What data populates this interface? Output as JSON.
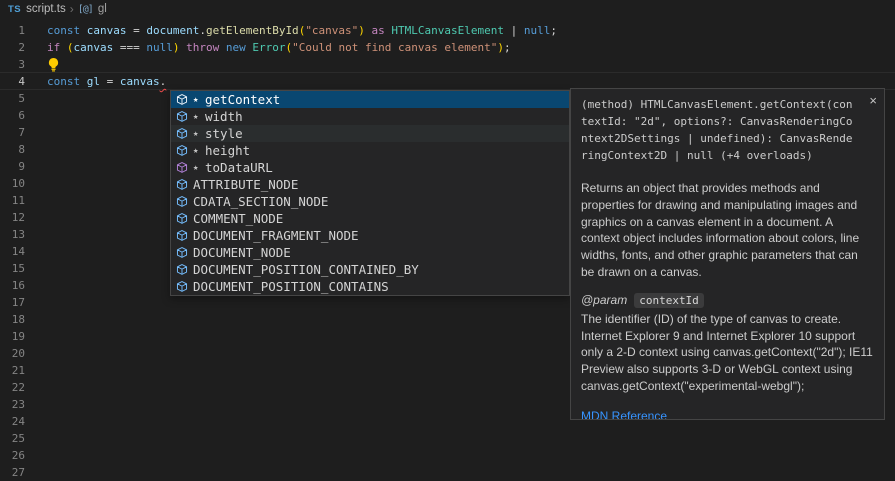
{
  "breadcrumb": {
    "file_icon": "TS",
    "file": "script.ts",
    "separator": "›",
    "symbol_icon": "[@]",
    "symbol": "gl"
  },
  "editor": {
    "line_count": 27,
    "active_line": 4,
    "code_lines": [
      {
        "line": 1,
        "tokens": [
          {
            "t": "const ",
            "c": "kw"
          },
          {
            "t": "canvas ",
            "c": "var"
          },
          {
            "t": "= ",
            "c": "op"
          },
          {
            "t": "document",
            "c": "var"
          },
          {
            "t": ".",
            "c": "op"
          },
          {
            "t": "getElementById",
            "c": "fn"
          },
          {
            "t": "(",
            "c": "br"
          },
          {
            "t": "\"canvas\"",
            "c": "str"
          },
          {
            "t": ")",
            "c": "br"
          },
          {
            "t": " as ",
            "c": "ctrl"
          },
          {
            "t": "HTMLCanvasElement ",
            "c": "type"
          },
          {
            "t": "| ",
            "c": "op"
          },
          {
            "t": "null",
            "c": "kw"
          },
          {
            "t": ";",
            "c": "op"
          }
        ]
      },
      {
        "line": 2,
        "tokens": [
          {
            "t": "if ",
            "c": "ctrl"
          },
          {
            "t": "(",
            "c": "br"
          },
          {
            "t": "canvas ",
            "c": "var"
          },
          {
            "t": "=== ",
            "c": "op"
          },
          {
            "t": "null",
            "c": "kw"
          },
          {
            "t": ")",
            "c": "br"
          },
          {
            "t": " throw ",
            "c": "ctrl"
          },
          {
            "t": "new ",
            "c": "kw"
          },
          {
            "t": "Error",
            "c": "type"
          },
          {
            "t": "(",
            "c": "br"
          },
          {
            "t": "\"Could not find canvas element\"",
            "c": "str"
          },
          {
            "t": ")",
            "c": "br"
          },
          {
            "t": ";",
            "c": "op"
          }
        ]
      },
      {
        "line": 3,
        "lightbulb": true,
        "tokens": []
      },
      {
        "line": 4,
        "tokens": [
          {
            "t": "const ",
            "c": "kw"
          },
          {
            "t": "gl ",
            "c": "var"
          },
          {
            "t": "= ",
            "c": "op"
          },
          {
            "t": "canvas",
            "c": "var"
          },
          {
            "t": ".",
            "c": "err"
          }
        ]
      }
    ]
  },
  "suggest": {
    "star_glyph": "★",
    "items": [
      {
        "label": "getContext",
        "kind": "method",
        "starred": true,
        "state": "selected"
      },
      {
        "label": "width",
        "kind": "field",
        "starred": true,
        "state": ""
      },
      {
        "label": "style",
        "kind": "field",
        "starred": true,
        "state": "hover"
      },
      {
        "label": "height",
        "kind": "field",
        "starred": true,
        "state": ""
      },
      {
        "label": "toDataURL",
        "kind": "method",
        "starred": true,
        "state": ""
      },
      {
        "label": "ATTRIBUTE_NODE",
        "kind": "field",
        "starred": false,
        "state": ""
      },
      {
        "label": "CDATA_SECTION_NODE",
        "kind": "field",
        "starred": false,
        "state": ""
      },
      {
        "label": "COMMENT_NODE",
        "kind": "field",
        "starred": false,
        "state": ""
      },
      {
        "label": "DOCUMENT_FRAGMENT_NODE",
        "kind": "field",
        "starred": false,
        "state": ""
      },
      {
        "label": "DOCUMENT_NODE",
        "kind": "field",
        "starred": false,
        "state": ""
      },
      {
        "label": "DOCUMENT_POSITION_CONTAINED_BY",
        "kind": "field",
        "starred": false,
        "state": ""
      },
      {
        "label": "DOCUMENT_POSITION_CONTAINS",
        "kind": "field",
        "starred": false,
        "state": ""
      }
    ]
  },
  "docs": {
    "close_glyph": "×",
    "signature": "(method) HTMLCanvasElement.getContext(contextId: \"2d\", options?: CanvasRenderingContext2DSettings | undefined): CanvasRenderingContext2D | null (+4 overloads)",
    "description": "Returns an object that provides methods and properties for drawing and manipulating images and graphics on a canvas element in a document. A context object includes information about colors, line widths, fonts, and other graphic parameters that can be drawn on a canvas.",
    "param_tag": "@param",
    "param_name": "contextId",
    "param_description": "The identifier (ID) of the type of canvas to create. Internet Explorer 9 and Internet Explorer 10 support only a 2-D context using canvas.getContext(\"2d\"); IE11 Preview also supports 3-D or WebGL context using canvas.getContext(\"experimental-webgl\");",
    "link": "MDN Reference"
  },
  "colors": {
    "editor_background": "#1e1e1e",
    "widget_background": "#252526",
    "selection_background": "#094771",
    "hover_background": "#2a2d2e",
    "method_icon": "#b180d7",
    "field_icon": "#75beff",
    "selected_icon": "#eaf3fb",
    "error_squiggle": "#f14c4c",
    "lightbulb": "#ffcc00",
    "link": "#3794ff",
    "bracket_gold": "#ffd700"
  }
}
